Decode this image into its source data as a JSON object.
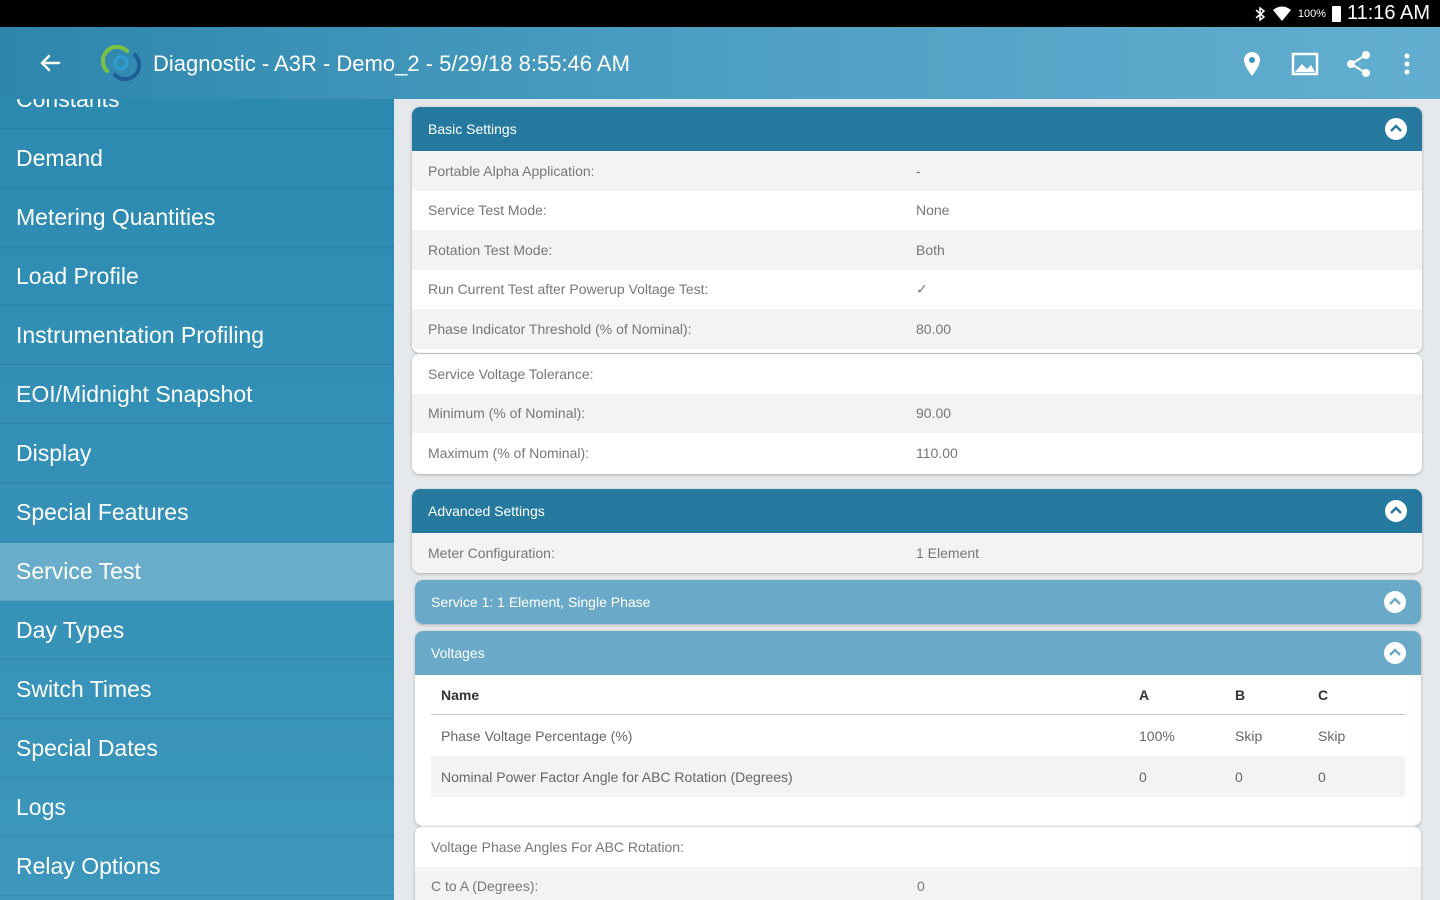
{
  "status_bar": {
    "battery": "100%",
    "time": "11:16 AM"
  },
  "app_bar": {
    "title": "Diagnostic - A3R - Demo_2 - 5/29/18 8:55:46 AM"
  },
  "sidebar": {
    "items": [
      {
        "label": "Constants"
      },
      {
        "label": "Demand"
      },
      {
        "label": "Metering Quantities"
      },
      {
        "label": "Load Profile"
      },
      {
        "label": "Instrumentation Profiling"
      },
      {
        "label": "EOI/Midnight Snapshot"
      },
      {
        "label": "Display"
      },
      {
        "label": "Special Features"
      },
      {
        "label": "Service Test"
      },
      {
        "label": "Day Types"
      },
      {
        "label": "Switch Times"
      },
      {
        "label": "Special Dates"
      },
      {
        "label": "Logs"
      },
      {
        "label": "Relay Options"
      }
    ],
    "active": "Service Test"
  },
  "basic": {
    "title": "Basic Settings",
    "rows": [
      {
        "label": "Portable Alpha Application:",
        "value": "-"
      },
      {
        "label": "Service Test Mode:",
        "value": "None"
      },
      {
        "label": "Rotation Test Mode:",
        "value": "Both"
      },
      {
        "label": "Run Current Test after Powerup Voltage Test:",
        "value": "✓"
      },
      {
        "label": "Phase Indicator Threshold (% of Nominal):",
        "value": "80.00"
      }
    ],
    "tolerance": {
      "title": "Service Voltage Tolerance:",
      "rows": [
        {
          "label": "Minimum (% of Nominal):",
          "value": "90.00"
        },
        {
          "label": "Maximum (% of Nominal):",
          "value": "110.00"
        }
      ]
    }
  },
  "advanced": {
    "title": "Advanced Settings",
    "rows": [
      {
        "label": "Meter Configuration:",
        "value": "1 Element"
      }
    ]
  },
  "service1": {
    "title": "Service 1: 1 Element, Single Phase"
  },
  "voltages": {
    "title": "Voltages",
    "columns": [
      "Name",
      "A",
      "B",
      "C"
    ],
    "rows": [
      [
        "Phase Voltage Percentage (%)",
        "100%",
        "Skip",
        "Skip"
      ],
      [
        "Nominal Power Factor Angle for ABC Rotation (Degrees)",
        "0",
        "0",
        "0"
      ]
    ]
  },
  "angles": {
    "title": "Voltage Phase Angles For ABC Rotation:",
    "rows": [
      {
        "label": "C to A (Degrees):",
        "value": "0"
      }
    ]
  }
}
